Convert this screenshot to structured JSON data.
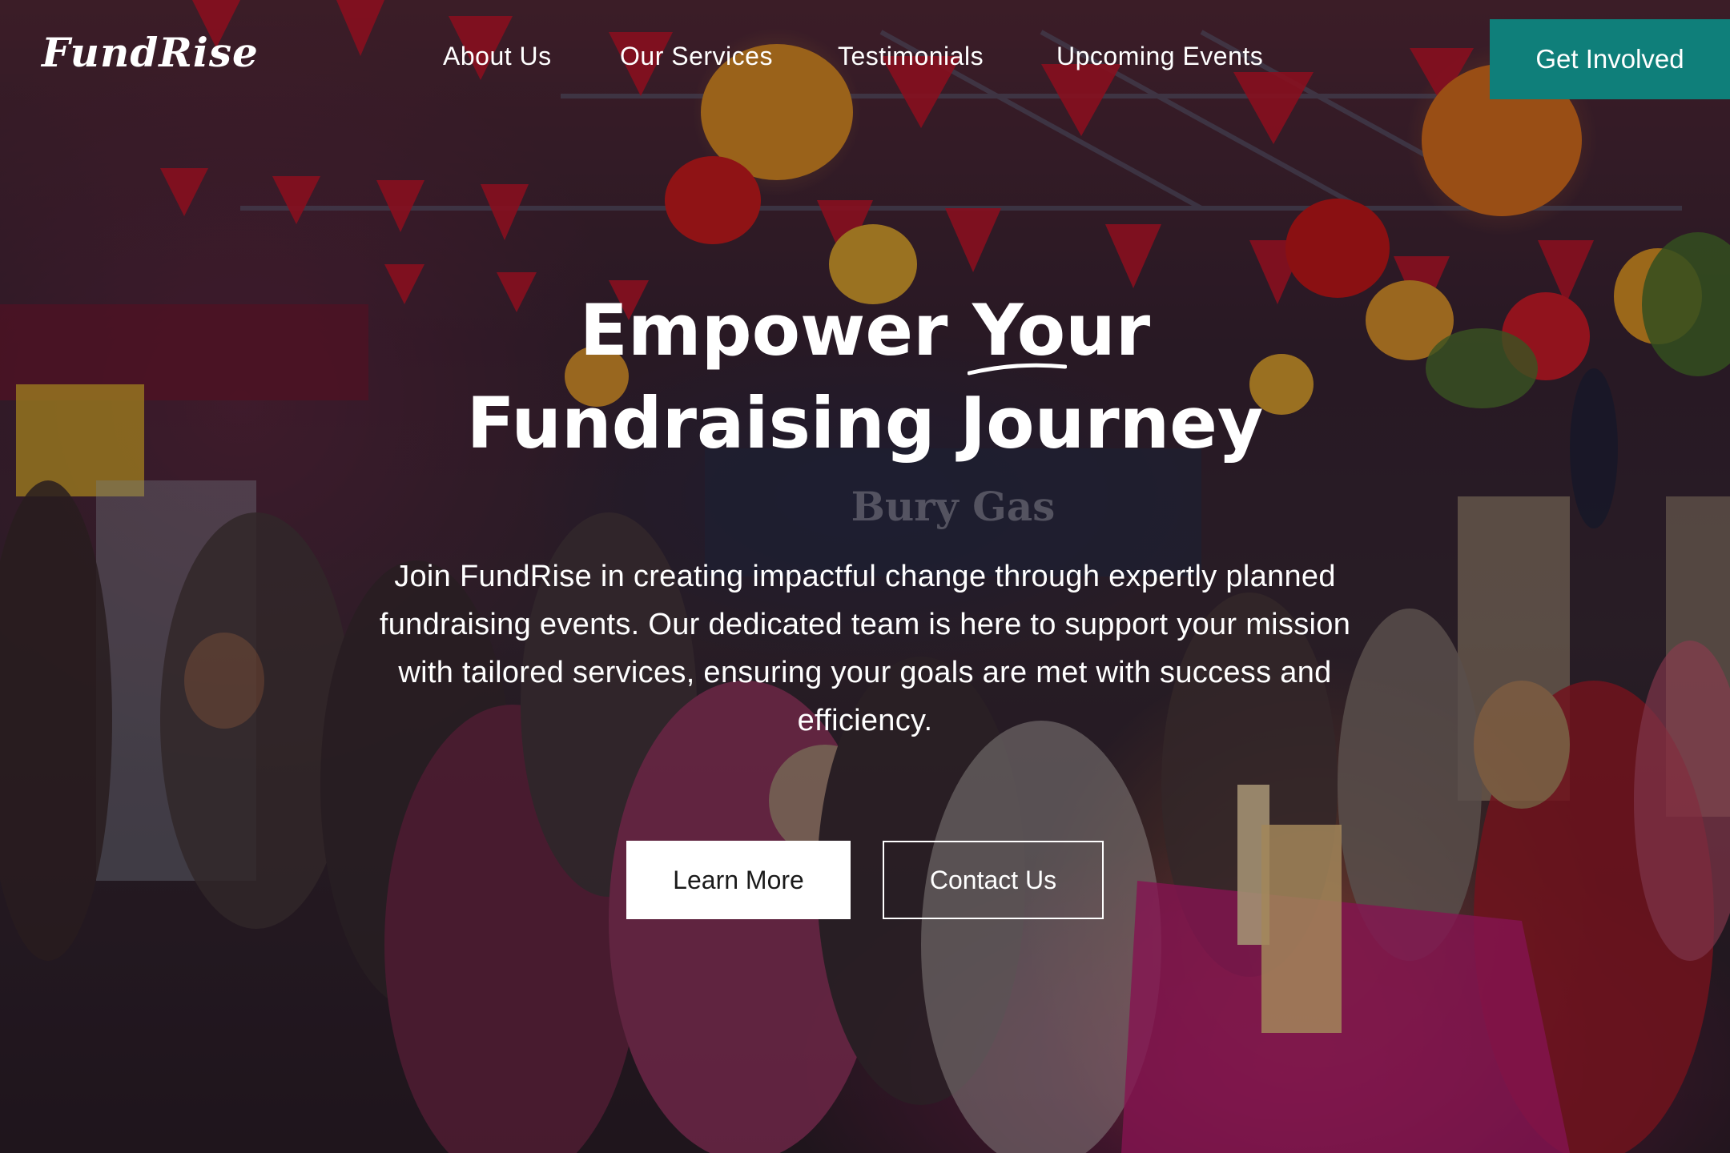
{
  "brand": {
    "logo_text": "FundRise",
    "accent_color": "#0f7f7a"
  },
  "nav": {
    "links": [
      {
        "label": "About Us"
      },
      {
        "label": "Our Services"
      },
      {
        "label": "Testimonials"
      },
      {
        "label": "Upcoming Events"
      }
    ],
    "cta_label": "Get Involved"
  },
  "hero": {
    "title_line1": "Empower Your",
    "title_line2": "Fundraising Journey",
    "description": "Join FundRise in creating impactful change through expertly planned fundraising events. Our dedicated team is here to support your mission with tailored services, ensuring your goals are met with success and efficiency.",
    "primary_button": "Learn More",
    "secondary_button": "Contact Us",
    "background_sign_text": "Bury Gas"
  }
}
